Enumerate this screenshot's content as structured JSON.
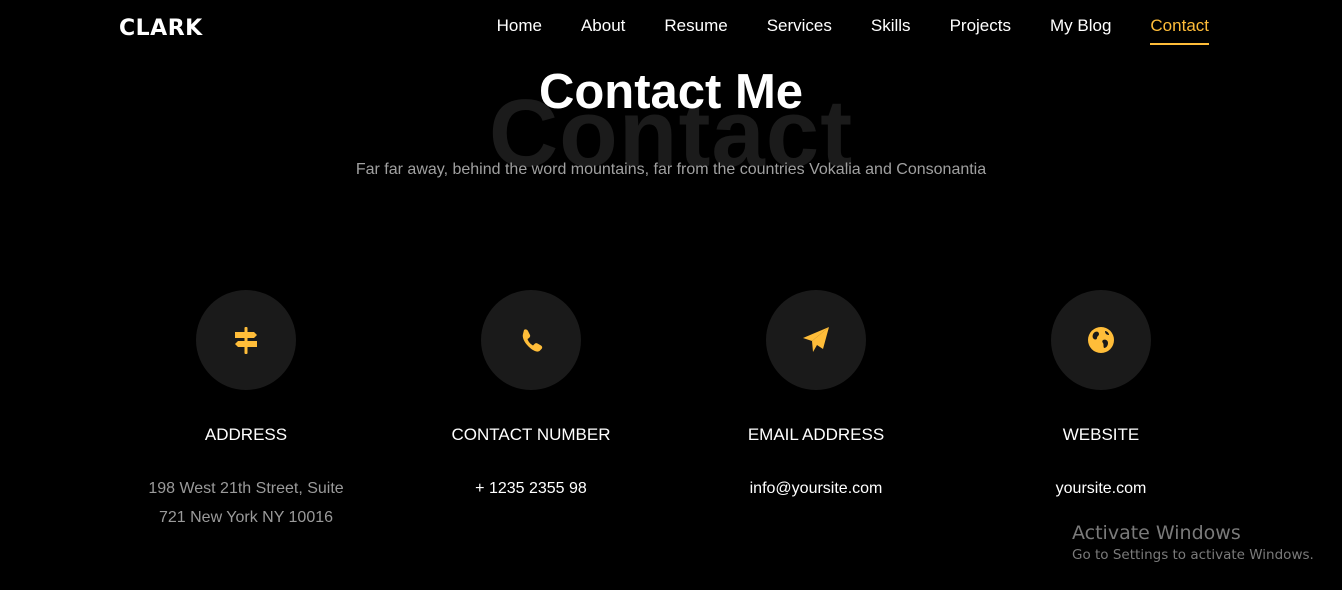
{
  "brand": "CLARK",
  "nav": {
    "items": [
      {
        "label": "Home"
      },
      {
        "label": "About"
      },
      {
        "label": "Resume"
      },
      {
        "label": "Services"
      },
      {
        "label": "Skills"
      },
      {
        "label": "Projects"
      },
      {
        "label": "My Blog"
      },
      {
        "label": "Contact",
        "active": true
      }
    ]
  },
  "heading": {
    "bg_word": "Contact",
    "title": "Contact Me",
    "subtitle": "Far far away, behind the word mountains, far from the countries Vokalia and Consonantia"
  },
  "cards": [
    {
      "icon": "signpost-icon",
      "title": "ADDRESS",
      "value": "198 West 21th Street, Suite 721 New York NY 10016"
    },
    {
      "icon": "phone-icon",
      "title": "CONTACT NUMBER",
      "value": "+ 1235 2355 98"
    },
    {
      "icon": "paper-plane-icon",
      "title": "EMAIL ADDRESS",
      "value": "info@yoursite.com"
    },
    {
      "icon": "globe-icon",
      "title": "WEBSITE",
      "value": "yoursite.com"
    }
  ],
  "colors": {
    "accent": "#ffbd39",
    "background": "#000000",
    "circle": "#1a1a1a"
  },
  "watermark": {
    "title": "Activate Windows",
    "subtitle": "Go to Settings to activate Windows."
  }
}
